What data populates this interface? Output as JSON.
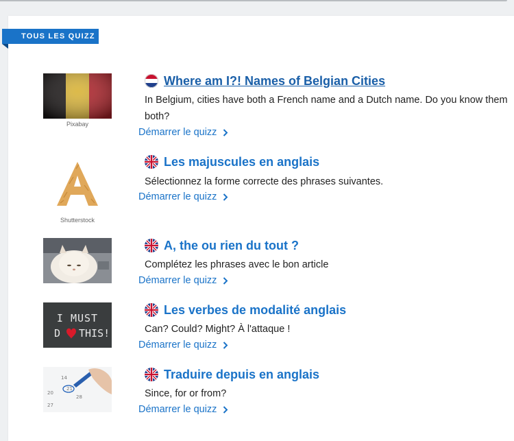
{
  "section": {
    "label": "TOUS LES QUIZZ"
  },
  "quizzes": [
    {
      "title": "Where am I?! Names of Belgian Cities",
      "description": "In Belgium, cities have both a French name and a Dutch name. Do you know them both?",
      "start_label": "Démarrer le quizz",
      "credit": "Pixabay",
      "flag": "netherlands-flag-icon",
      "image": "belgian-flag-image"
    },
    {
      "title": "Les majuscules en anglais",
      "description": "Sélectionnez la forme correcte des phrases suivantes.",
      "start_label": "Démarrer le quizz",
      "credit": "Shutterstock",
      "flag": "uk-flag-icon",
      "image": "pasta-letter-a-image"
    },
    {
      "title": "A, the ou rien du tout ?",
      "description": "Complétez les phrases avec le bon article",
      "start_label": "Démarrer le quizz",
      "flag": "uk-flag-icon",
      "image": "persian-cat-image"
    },
    {
      "title": "Les verbes de modalité anglais",
      "description": "Can? Could? Might? À l'attaque !",
      "start_label": "Démarrer le quizz",
      "flag": "uk-flag-icon",
      "image": "chalkboard-i-must-do-this-image",
      "image_text_1": "I MUST",
      "image_text_2": "D",
      "image_text_3": "THIS!"
    },
    {
      "title": "Traduire depuis en anglais",
      "description": "Since, for or from?",
      "start_label": "Démarrer le quizz",
      "flag": "uk-flag-icon",
      "image": "calendar-pen-image",
      "image_text_1": "14",
      "image_text_2": "21",
      "image_text_3": "28",
      "image_text_4": "20",
      "image_text_5": "27"
    }
  ],
  "colors": {
    "accent": "#1a73c8",
    "ribbon": "#1a73c8",
    "text": "#222222"
  }
}
